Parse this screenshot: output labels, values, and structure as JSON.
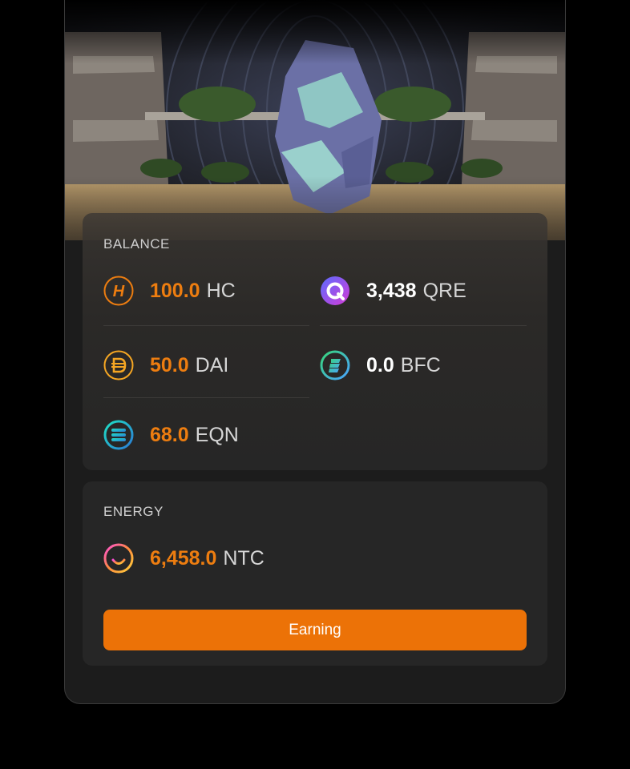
{
  "balance": {
    "title": "BALANCE",
    "tokens": [
      {
        "amount": "100.0",
        "symbol": "HC",
        "icon": "hc-coin-icon"
      },
      {
        "amount": "3,438",
        "symbol": "QRE",
        "icon": "qre-coin-icon"
      },
      {
        "amount": "50.0",
        "symbol": "DAI",
        "icon": "dai-coin-icon"
      },
      {
        "amount": "0.0",
        "symbol": "BFC",
        "icon": "bfc-coin-icon"
      },
      {
        "amount": "68.0",
        "symbol": "EQN",
        "icon": "eqn-coin-icon"
      }
    ]
  },
  "energy": {
    "title": "ENERGY",
    "token": {
      "amount": "6,458.0",
      "symbol": "NTC",
      "icon": "ntc-coin-icon"
    },
    "button_label": "Earning"
  },
  "colors": {
    "accent": "#ec7207",
    "card": "#262626",
    "background": "#000000"
  }
}
